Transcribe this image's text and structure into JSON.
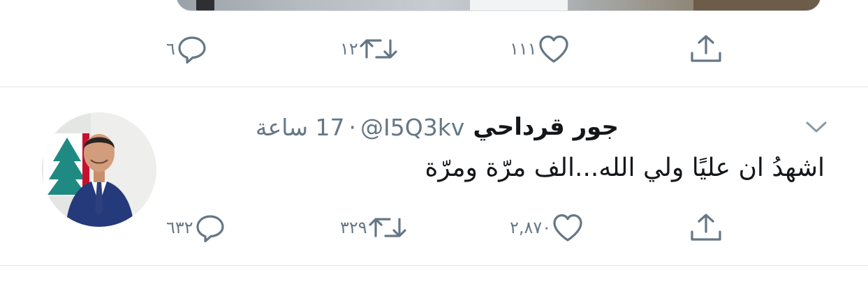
{
  "previous_tweet": {
    "actions": {
      "reply_count": "٦",
      "retweet_count": "١٢",
      "like_count": "١١١"
    }
  },
  "tweet": {
    "author_name": "جور قرداحي",
    "handle": "@I5Q3kv",
    "separator": "·",
    "time": "17 ساعة",
    "text": "اشهدُ ان عليًا ولي الله...الف مرّة ومرّة",
    "actions": {
      "reply_count": "٦٣٢",
      "retweet_count": "٣٢٩",
      "like_count": "٢,٨٧٠"
    }
  },
  "icons": {
    "reply": "reply-icon",
    "retweet": "retweet-icon",
    "like": "heart-icon",
    "share": "share-icon",
    "more": "chevron-down-icon"
  },
  "colors": {
    "icon_gray": "#657786",
    "text_dark": "#14171a",
    "divider": "#dfe3e6"
  }
}
